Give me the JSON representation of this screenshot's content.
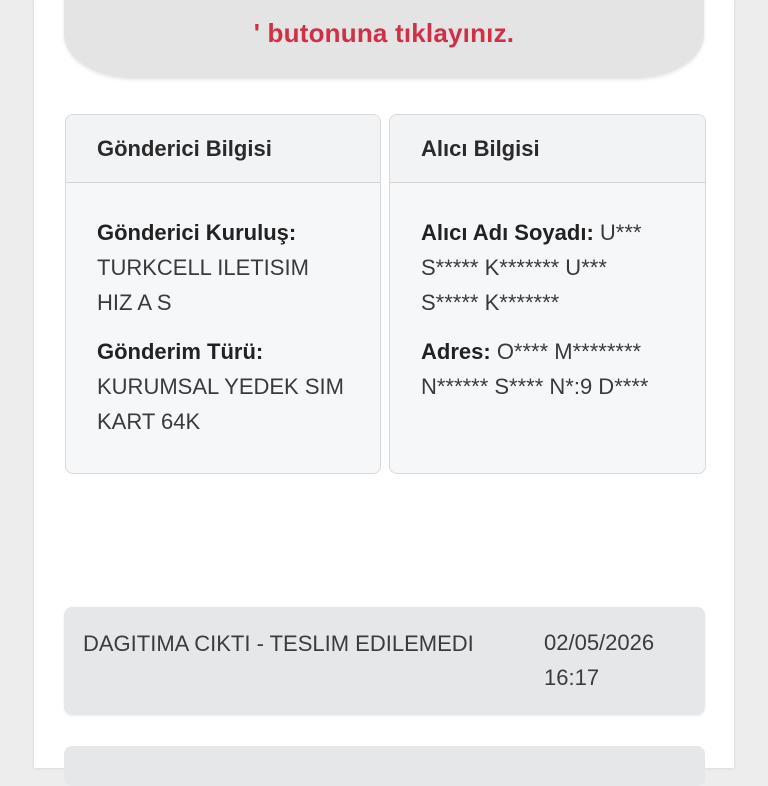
{
  "notice": {
    "text": "' butonuna tıklayınız."
  },
  "sender_card": {
    "title": "Gönderici Bilgisi",
    "org_label": "Gönderici Kuruluş:",
    "org_value": "TURKCELL ILETISIM HIZ A S",
    "type_label": "Gönderim Türü:",
    "type_value": "KURUMSAL YEDEK SIM KART 64K"
  },
  "receiver_card": {
    "title": "Alıcı Bilgisi",
    "name_label": "Alıcı Adı Soyadı:",
    "name_value": "U*** S***** K******* U*** S***** K*******",
    "address_label": "Adres:",
    "address_value": "O**** M******** N****** S**** N*:9 D****"
  },
  "status_rows": [
    {
      "status": "DAGITIMA CIKTI - TESLIM EDILEMEDI",
      "date": "02/05/2026",
      "time": "16:17"
    }
  ]
}
